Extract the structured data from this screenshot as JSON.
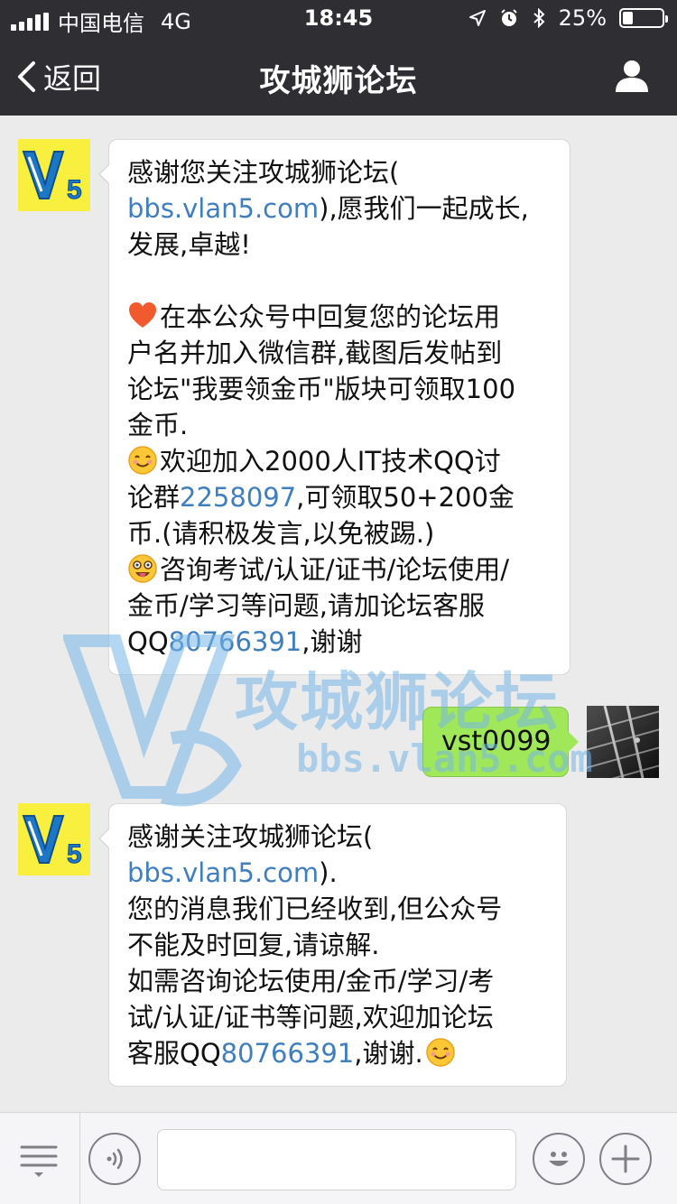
{
  "status_bar": {
    "carrier": "中国电信",
    "network": "4G",
    "time": "18:45",
    "battery_text": "25%",
    "battery_level": 0.25
  },
  "nav": {
    "back_label": "返回",
    "title": "攻城狮论坛",
    "back_icon": "chevron-left-icon",
    "right_icon": "person-icon"
  },
  "messages": [
    {
      "direction": "incoming",
      "avatar_text": "V5",
      "paragraph1": [
        "感谢您关注攻城狮论坛(",
        [
          "bbs.vlan5.com",
          "),愿我们一起成长,"
        ],
        "发展,卓越!"
      ],
      "p2_l1": "在本公众号中回复您的论坛用",
      "p2_l2": "户名并加入微信群,截图后发帖到",
      "p2_l3": "论坛\"我要领金币\"版块可领取100",
      "p2_l4": "金币.",
      "p3_l1": "欢迎加入2000人IT技术QQ讨",
      "p3_l2_pre": "论群",
      "p3_l2_link": "2258097",
      "p3_l2_post": ",可领取50+200金",
      "p3_l3": "币.(请积极发言,以免被踢.)",
      "p4_l1": "咨询考试/认证/证书/论坛使用/",
      "p4_l2": "金币/学习等问题,请加论坛客服",
      "p4_l3_pre": "QQ",
      "p4_l3_link": "80766391",
      "p4_l3_post": ",谢谢"
    },
    {
      "direction": "outgoing",
      "text": "vst0099"
    },
    {
      "direction": "incoming",
      "avatar_text": "V5",
      "l1": "感谢关注攻城狮论坛(",
      "l2_link": "bbs.vlan5.com",
      "l2_post": ").",
      "l3": "您的消息我们已经收到,但公众号",
      "l4": "不能及时回复,请谅解.",
      "l5": "如需咨询论坛使用/金币/学习/考",
      "l6": "试/认证/证书等问题,欢迎加论坛",
      "l7_pre": "客服QQ",
      "l7_link": "80766391",
      "l7_post": ",谢谢."
    }
  ],
  "watermark": {
    "title": "攻城狮论坛",
    "url": "bbs.vlan5.com"
  },
  "input_bar": {
    "input_value": "",
    "input_placeholder": "",
    "icons": [
      "menu-icon",
      "voice-icon",
      "emoji-icon",
      "plus-icon"
    ]
  },
  "colors": {
    "nav_bg": "#2e2e33",
    "chat_bg": "#ebebeb",
    "outgoing_bubble": "#a0e75a",
    "link": "#3f7fbf",
    "avatar_bg": "#f9ef3e"
  }
}
